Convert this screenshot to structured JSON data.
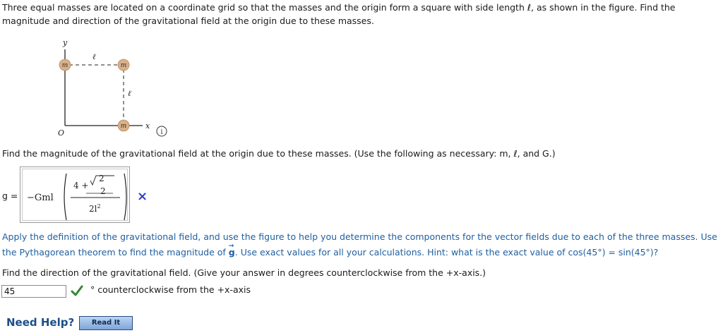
{
  "problem": {
    "intro": "Three equal masses are located on a coordinate grid so that the masses and the origin form a square with side length ℓ, as shown in the figure. Find the magnitude and direction of the gravitational field at the origin due to these masses.",
    "q1": "Find the magnitude of the gravitational field at the origin due to these masses. (Use the following as necessary: m, ℓ, and G.)",
    "feedback_part1": "Apply the definition of the gravitational field, and use the figure to help you determine the components for the vector fields due to each of the three masses. Use the Pythagorean theorem to find the magnitude of ",
    "feedback_vec": "g",
    "feedback_part2": ". Use exact values for all your calculations. Hint: what is the exact value of cos(45°) = sin(45°)?",
    "q2": "Find the direction of the gravitational field. (Give your answer in degrees counterclockwise from the +x-axis.)"
  },
  "figure": {
    "y_label": "y",
    "x_label": "x",
    "origin_label": "O",
    "side_label": "ℓ",
    "mass_label": "m",
    "info_symbol": "i"
  },
  "answer1": {
    "lhs": "g =",
    "prefix": "−Gml",
    "num_a": "4 +",
    "sqrt_val": "2",
    "inner_den": "2",
    "den": "2l",
    "den_exp": "2",
    "status": "incorrect",
    "status_icon": "×"
  },
  "answer2": {
    "value": "45",
    "status": "correct",
    "unit": "° counterclockwise from the +x-axis"
  },
  "help": {
    "label": "Need Help?",
    "read_it": "Read It"
  },
  "colors": {
    "mass_fill": "#d8b08a",
    "feedback_text": "#1f5fa0",
    "incorrect": "#2f3fc4",
    "correct": "#2e8b2e"
  }
}
